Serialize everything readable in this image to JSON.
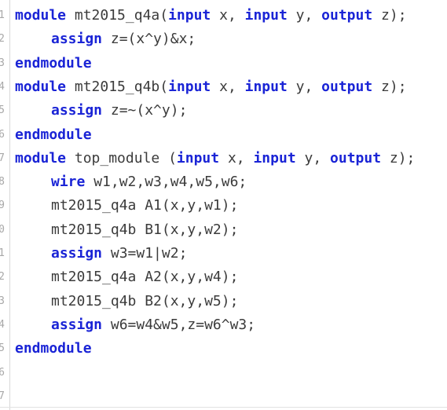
{
  "editor": {
    "line_numbers": [
      "1",
      "2",
      "3",
      "4",
      "5",
      "6",
      "7",
      "8",
      "9",
      "0",
      "1",
      "2",
      "3",
      "4",
      "5",
      "6",
      "7"
    ],
    "lines": [
      {
        "indent": false,
        "tokens": [
          {
            "kw": true,
            "text": "module"
          },
          {
            "kw": false,
            "text": " mt2015_q4a("
          },
          {
            "kw": true,
            "text": "input"
          },
          {
            "kw": false,
            "text": " x, "
          },
          {
            "kw": true,
            "text": "input"
          },
          {
            "kw": false,
            "text": " y, "
          },
          {
            "kw": true,
            "text": "output"
          },
          {
            "kw": false,
            "text": " z);"
          }
        ]
      },
      {
        "indent": true,
        "tokens": [
          {
            "kw": true,
            "text": "assign"
          },
          {
            "kw": false,
            "text": " z=(x^y)&x;"
          }
        ]
      },
      {
        "indent": false,
        "tokens": [
          {
            "kw": true,
            "text": "endmodule"
          }
        ]
      },
      {
        "indent": false,
        "tokens": [
          {
            "kw": true,
            "text": "module"
          },
          {
            "kw": false,
            "text": " mt2015_q4b("
          },
          {
            "kw": true,
            "text": "input"
          },
          {
            "kw": false,
            "text": " x, "
          },
          {
            "kw": true,
            "text": "input"
          },
          {
            "kw": false,
            "text": " y, "
          },
          {
            "kw": true,
            "text": "output"
          },
          {
            "kw": false,
            "text": " z);"
          }
        ]
      },
      {
        "indent": true,
        "tokens": [
          {
            "kw": true,
            "text": "assign"
          },
          {
            "kw": false,
            "text": " z=~(x^y);"
          }
        ]
      },
      {
        "indent": false,
        "tokens": [
          {
            "kw": true,
            "text": "endmodule"
          }
        ]
      },
      {
        "indent": false,
        "tokens": [
          {
            "kw": true,
            "text": "module"
          },
          {
            "kw": false,
            "text": " top_module ("
          },
          {
            "kw": true,
            "text": "input"
          },
          {
            "kw": false,
            "text": " x, "
          },
          {
            "kw": true,
            "text": "input"
          },
          {
            "kw": false,
            "text": " y, "
          },
          {
            "kw": true,
            "text": "output"
          },
          {
            "kw": false,
            "text": " z);"
          }
        ]
      },
      {
        "indent": true,
        "tokens": [
          {
            "kw": true,
            "text": "wire"
          },
          {
            "kw": false,
            "text": " w1,w2,w3,w4,w5,w6;"
          }
        ]
      },
      {
        "indent": true,
        "tokens": [
          {
            "kw": false,
            "text": "mt2015_q4a A1(x,y,w1);"
          }
        ]
      },
      {
        "indent": true,
        "tokens": [
          {
            "kw": false,
            "text": "mt2015_q4b B1(x,y,w2);"
          }
        ]
      },
      {
        "indent": true,
        "tokens": [
          {
            "kw": true,
            "text": "assign"
          },
          {
            "kw": false,
            "text": " w3=w1|w2;"
          }
        ]
      },
      {
        "indent": true,
        "tokens": [
          {
            "kw": false,
            "text": "mt2015_q4a A2(x,y,w4);"
          }
        ]
      },
      {
        "indent": true,
        "tokens": [
          {
            "kw": false,
            "text": "mt2015_q4b B2(x,y,w5);"
          }
        ]
      },
      {
        "indent": true,
        "tokens": [
          {
            "kw": true,
            "text": "assign"
          },
          {
            "kw": false,
            "text": " w6=w4&w5,z=w6^w3;"
          }
        ]
      },
      {
        "indent": false,
        "tokens": [
          {
            "kw": true,
            "text": "endmodule"
          }
        ]
      },
      {
        "indent": false,
        "tokens": []
      },
      {
        "indent": false,
        "tokens": []
      }
    ],
    "colors": {
      "keyword": "#1a24d6",
      "text": "#3b3b3b",
      "line_number": "#a8a8a8",
      "background": "#ffffff"
    }
  }
}
